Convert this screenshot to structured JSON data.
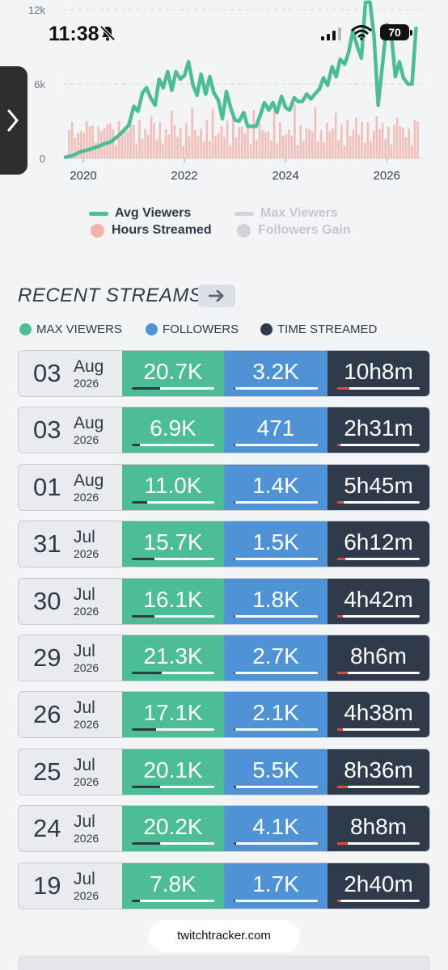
{
  "status_bar": {
    "time": "11:38",
    "battery": "70"
  },
  "chart_data": {
    "type": "line",
    "x_ticks": [
      "2020",
      "2022",
      "2024",
      "2026"
    ],
    "y_ticks": [
      "12k",
      "6k",
      "0"
    ],
    "ylim": [
      0,
      12000
    ],
    "x_range": [
      2019.6,
      2026.7
    ],
    "series": [
      {
        "name": "Avg Viewers",
        "color": "#4cbd95",
        "x": [
          2019.65,
          2019.8,
          2019.95,
          2020.1,
          2020.25,
          2020.4,
          2020.55,
          2020.7,
          2020.8,
          2020.9,
          2021.0,
          2021.08,
          2021.17,
          2021.25,
          2021.33,
          2021.42,
          2021.5,
          2021.58,
          2021.67,
          2021.75,
          2021.83,
          2021.92,
          2022.0,
          2022.08,
          2022.17,
          2022.25,
          2022.33,
          2022.42,
          2022.5,
          2022.58,
          2022.67,
          2022.75,
          2022.83,
          2022.92,
          2023.0,
          2023.08,
          2023.17,
          2023.25,
          2023.33,
          2023.42,
          2023.5,
          2023.58,
          2023.67,
          2023.75,
          2023.83,
          2023.92,
          2024.0,
          2024.08,
          2024.17,
          2024.25,
          2024.33,
          2024.42,
          2024.5,
          2024.58,
          2024.67,
          2024.75,
          2024.83,
          2024.92,
          2025.0,
          2025.08,
          2025.17,
          2025.25,
          2025.33,
          2025.42,
          2025.5,
          2025.58,
          2025.67,
          2025.75,
          2025.83,
          2025.92,
          2026.0,
          2026.08,
          2026.17,
          2026.25,
          2026.33,
          2026.42,
          2026.5,
          2026.58
        ],
        "values": [
          100,
          250,
          550,
          700,
          900,
          1150,
          1350,
          1850,
          2250,
          2700,
          4200,
          3800,
          5300,
          5700,
          4900,
          4300,
          6400,
          5700,
          7000,
          5500,
          7000,
          6400,
          6700,
          7800,
          5900,
          5100,
          6800,
          5200,
          6600,
          5300,
          4700,
          3200,
          5400,
          4000,
          3100,
          3000,
          3700,
          2600,
          2600,
          2600,
          3500,
          4500,
          3900,
          4500,
          3700,
          5000,
          4100,
          3900,
          4900,
          4600,
          4600,
          5200,
          4800,
          5200,
          5600,
          6500,
          5900,
          7400,
          6600,
          8000,
          7600,
          8600,
          10300,
          9000,
          8100,
          12600,
          12600,
          9800,
          4300,
          7700,
          10800,
          10500,
          6600,
          7800,
          6500,
          6000,
          6000,
          10500
        ]
      }
    ],
    "legend": [
      {
        "label": "Avg Viewers",
        "kind": "line",
        "color": "#4cbd95",
        "active": true
      },
      {
        "label": "Max Viewers",
        "kind": "line",
        "color": "#d1d5db",
        "active": false
      },
      {
        "label": "Hours Streamed",
        "kind": "dot",
        "color": "#f2b3ad",
        "active": true
      },
      {
        "label": "Followers Gain",
        "kind": "dot",
        "color": "#cfd3d8",
        "active": false
      }
    ]
  },
  "recent_streams": {
    "title": "RECENT STREAMS",
    "keys": [
      {
        "label": "MAX VIEWERS",
        "color": "#4cbd95"
      },
      {
        "label": "FOLLOWERS",
        "color": "#4f93d6"
      },
      {
        "label": "TIME STREAMED",
        "color": "#2f3a4b"
      }
    ],
    "rows": [
      {
        "day": "03",
        "month": "Aug",
        "year": "2026",
        "max_viewers": "20.7K",
        "followers": "3.2K",
        "time": "10h8m",
        "viewers_level": 0.34,
        "followers_level": 0.02,
        "time_level": 0.15
      },
      {
        "day": "03",
        "month": "Aug",
        "year": "2026",
        "max_viewers": "6.9K",
        "followers": "471",
        "time": "2h31m",
        "viewers_level": 0.1,
        "followers_level": 0.01,
        "time_level": 0.04
      },
      {
        "day": "01",
        "month": "Aug",
        "year": "2026",
        "max_viewers": "11.0K",
        "followers": "1.4K",
        "time": "5h45m",
        "viewers_level": 0.19,
        "followers_level": 0.01,
        "time_level": 0.08
      },
      {
        "day": "31",
        "month": "Jul",
        "year": "2026",
        "max_viewers": "15.7K",
        "followers": "1.5K",
        "time": "6h12m",
        "viewers_level": 0.27,
        "followers_level": 0.01,
        "time_level": 0.1
      },
      {
        "day": "30",
        "month": "Jul",
        "year": "2026",
        "max_viewers": "16.1K",
        "followers": "1.8K",
        "time": "4h42m",
        "viewers_level": 0.27,
        "followers_level": 0.01,
        "time_level": 0.07
      },
      {
        "day": "29",
        "month": "Jul",
        "year": "2026",
        "max_viewers": "21.3K",
        "followers": "2.7K",
        "time": "8h6m",
        "viewers_level": 0.36,
        "followers_level": 0.02,
        "time_level": 0.13
      },
      {
        "day": "26",
        "month": "Jul",
        "year": "2026",
        "max_viewers": "17.1K",
        "followers": "2.1K",
        "time": "4h38m",
        "viewers_level": 0.29,
        "followers_level": 0.01,
        "time_level": 0.07
      },
      {
        "day": "25",
        "month": "Jul",
        "year": "2026",
        "max_viewers": "20.1K",
        "followers": "5.5K",
        "time": "8h36m",
        "viewers_level": 0.34,
        "followers_level": 0.03,
        "time_level": 0.13
      },
      {
        "day": "24",
        "month": "Jul",
        "year": "2026",
        "max_viewers": "20.2K",
        "followers": "4.1K",
        "time": "8h8m",
        "viewers_level": 0.34,
        "followers_level": 0.03,
        "time_level": 0.13
      },
      {
        "day": "19",
        "month": "Jul",
        "year": "2026",
        "max_viewers": "7.8K",
        "followers": "1.7K",
        "time": "2h40m",
        "viewers_level": 0.1,
        "followers_level": 0.01,
        "time_level": 0.04
      }
    ]
  },
  "footer": {
    "site": "twitchtracker.com"
  }
}
